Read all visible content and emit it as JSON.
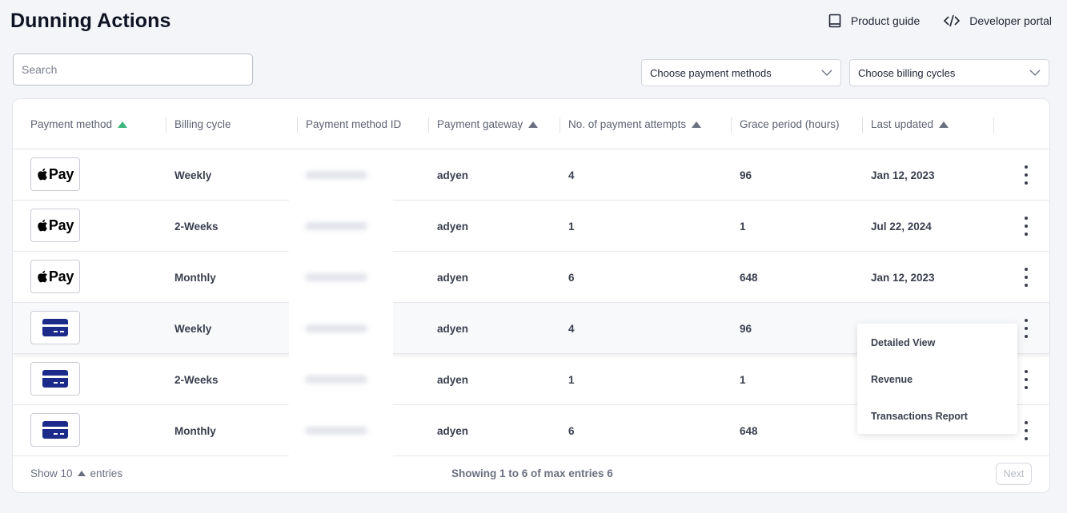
{
  "page_title": "Dunning Actions",
  "top_links": {
    "product_guide": "Product guide",
    "developer_portal": "Developer portal"
  },
  "search": {
    "placeholder": "Search",
    "value": ""
  },
  "filters": {
    "payment_methods": "Choose payment methods",
    "billing_cycles": "Choose billing cycles"
  },
  "table": {
    "columns": [
      "Payment method",
      "Billing cycle",
      "Payment method ID",
      "Payment gateway",
      "No. of payment attempts",
      "Grace period (hours)",
      "Last updated"
    ],
    "rows": [
      {
        "method": "Apple Pay",
        "method_icon": "apple-pay-icon",
        "apay_label": "Pay",
        "cycle": "Weekly",
        "gateway": "adyen",
        "attempts": "4",
        "grace": "96",
        "updated": "Jan 12, 2023"
      },
      {
        "method": "Apple Pay",
        "method_icon": "apple-pay-icon",
        "apay_label": "Pay",
        "cycle": "2-Weeks",
        "gateway": "adyen",
        "attempts": "1",
        "grace": "1",
        "updated": "Jul 22, 2024"
      },
      {
        "method": "Apple Pay",
        "method_icon": "apple-pay-icon",
        "apay_label": "Pay",
        "cycle": "Monthly",
        "gateway": "adyen",
        "attempts": "6",
        "grace": "648",
        "updated": "Jan 12, 2023"
      },
      {
        "method": "Card",
        "method_icon": "credit-card-icon",
        "cycle": "Weekly",
        "gateway": "adyen",
        "attempts": "4",
        "grace": "96",
        "updated": ""
      },
      {
        "method": "Card",
        "method_icon": "credit-card-icon",
        "cycle": "2-Weeks",
        "gateway": "adyen",
        "attempts": "1",
        "grace": "1",
        "updated": ""
      },
      {
        "method": "Card",
        "method_icon": "credit-card-icon",
        "cycle": "Monthly",
        "gateway": "adyen",
        "attempts": "6",
        "grace": "648",
        "updated": ""
      }
    ]
  },
  "context_menu": {
    "items": [
      "Detailed View",
      "Revenue",
      "Transactions Report"
    ]
  },
  "footer": {
    "show_label": "Show 10",
    "entries_label": "entries",
    "showing_text": "Showing 1 to 6 of max entries 6",
    "next_label": "Next"
  },
  "colors": {
    "sort_active": "#3bb57d",
    "card_icon": "#1c2a8a"
  }
}
